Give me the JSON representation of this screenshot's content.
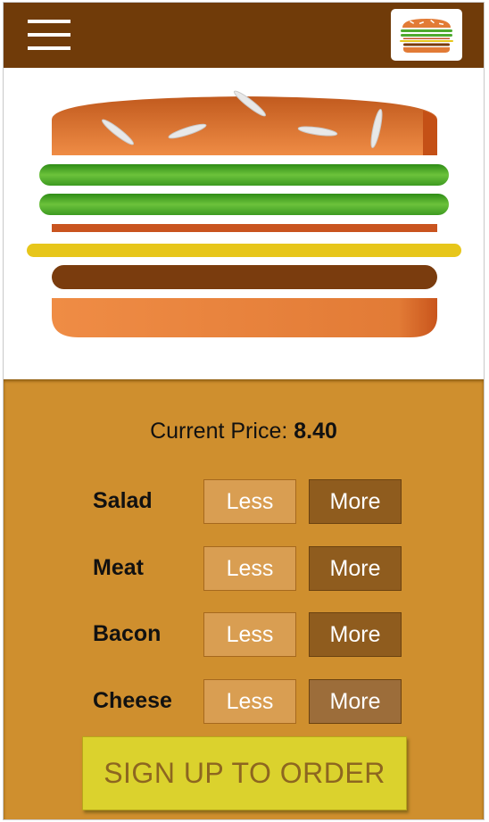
{
  "toolbar": {
    "menu_icon": "hamburger-menu-icon",
    "logo_icon": "burger-logo-icon",
    "colors": {
      "background": "#703b09"
    }
  },
  "burger": {
    "layers": [
      "bread-top",
      "salad",
      "salad",
      "bacon",
      "cheese",
      "meat",
      "bread-bottom"
    ],
    "colors": {
      "bread": "#e27b36",
      "salad": "#4daa2f",
      "bacon": "#c15024",
      "cheese": "#e7c61a",
      "meat": "#7a3c0e"
    }
  },
  "controls": {
    "price_label": "Current Price:",
    "price_value": "8.40",
    "items": [
      {
        "label": "Salad",
        "less": "Less",
        "more": "More"
      },
      {
        "label": "Meat",
        "less": "Less",
        "more": "More"
      },
      {
        "label": "Bacon",
        "less": "Less",
        "more": "More"
      },
      {
        "label": "Cheese",
        "less": "Less",
        "more": "More"
      }
    ],
    "order_button": "SIGN UP TO ORDER",
    "colors": {
      "panel": "#cf8f2e",
      "order": "#dbd22d"
    }
  }
}
